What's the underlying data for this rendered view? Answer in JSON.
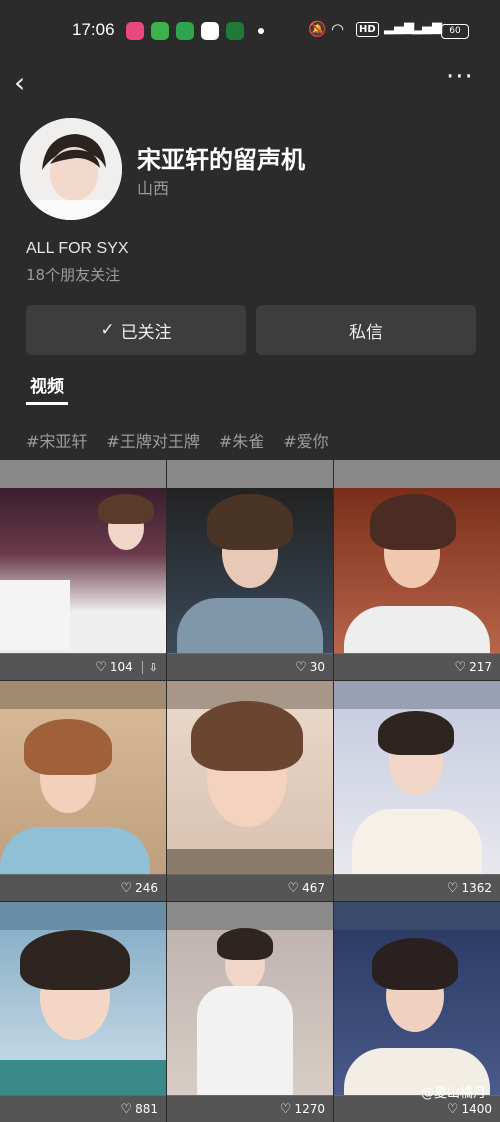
{
  "status_bar": {
    "time": "17:06",
    "hd": "HD",
    "battery": "60"
  },
  "profile": {
    "name": "宋亚轩的留声机",
    "region": "山西",
    "bio": "ALL FOR SYX",
    "friends": "18个朋友关注"
  },
  "actions": {
    "follow": "已关注",
    "message": "私信"
  },
  "tab": "视频",
  "tags": [
    "#宋亚轩",
    "#王牌对王牌",
    "#朱雀",
    "#爱你"
  ],
  "videos": [
    {
      "likes": "104"
    },
    {
      "likes": "30"
    },
    {
      "likes": "217"
    },
    {
      "likes": "246"
    },
    {
      "likes": "467"
    },
    {
      "likes": "1362"
    },
    {
      "likes": "881"
    },
    {
      "likes": "1270"
    },
    {
      "likes": "1400"
    }
  ],
  "watermark": "@夏山橘月"
}
